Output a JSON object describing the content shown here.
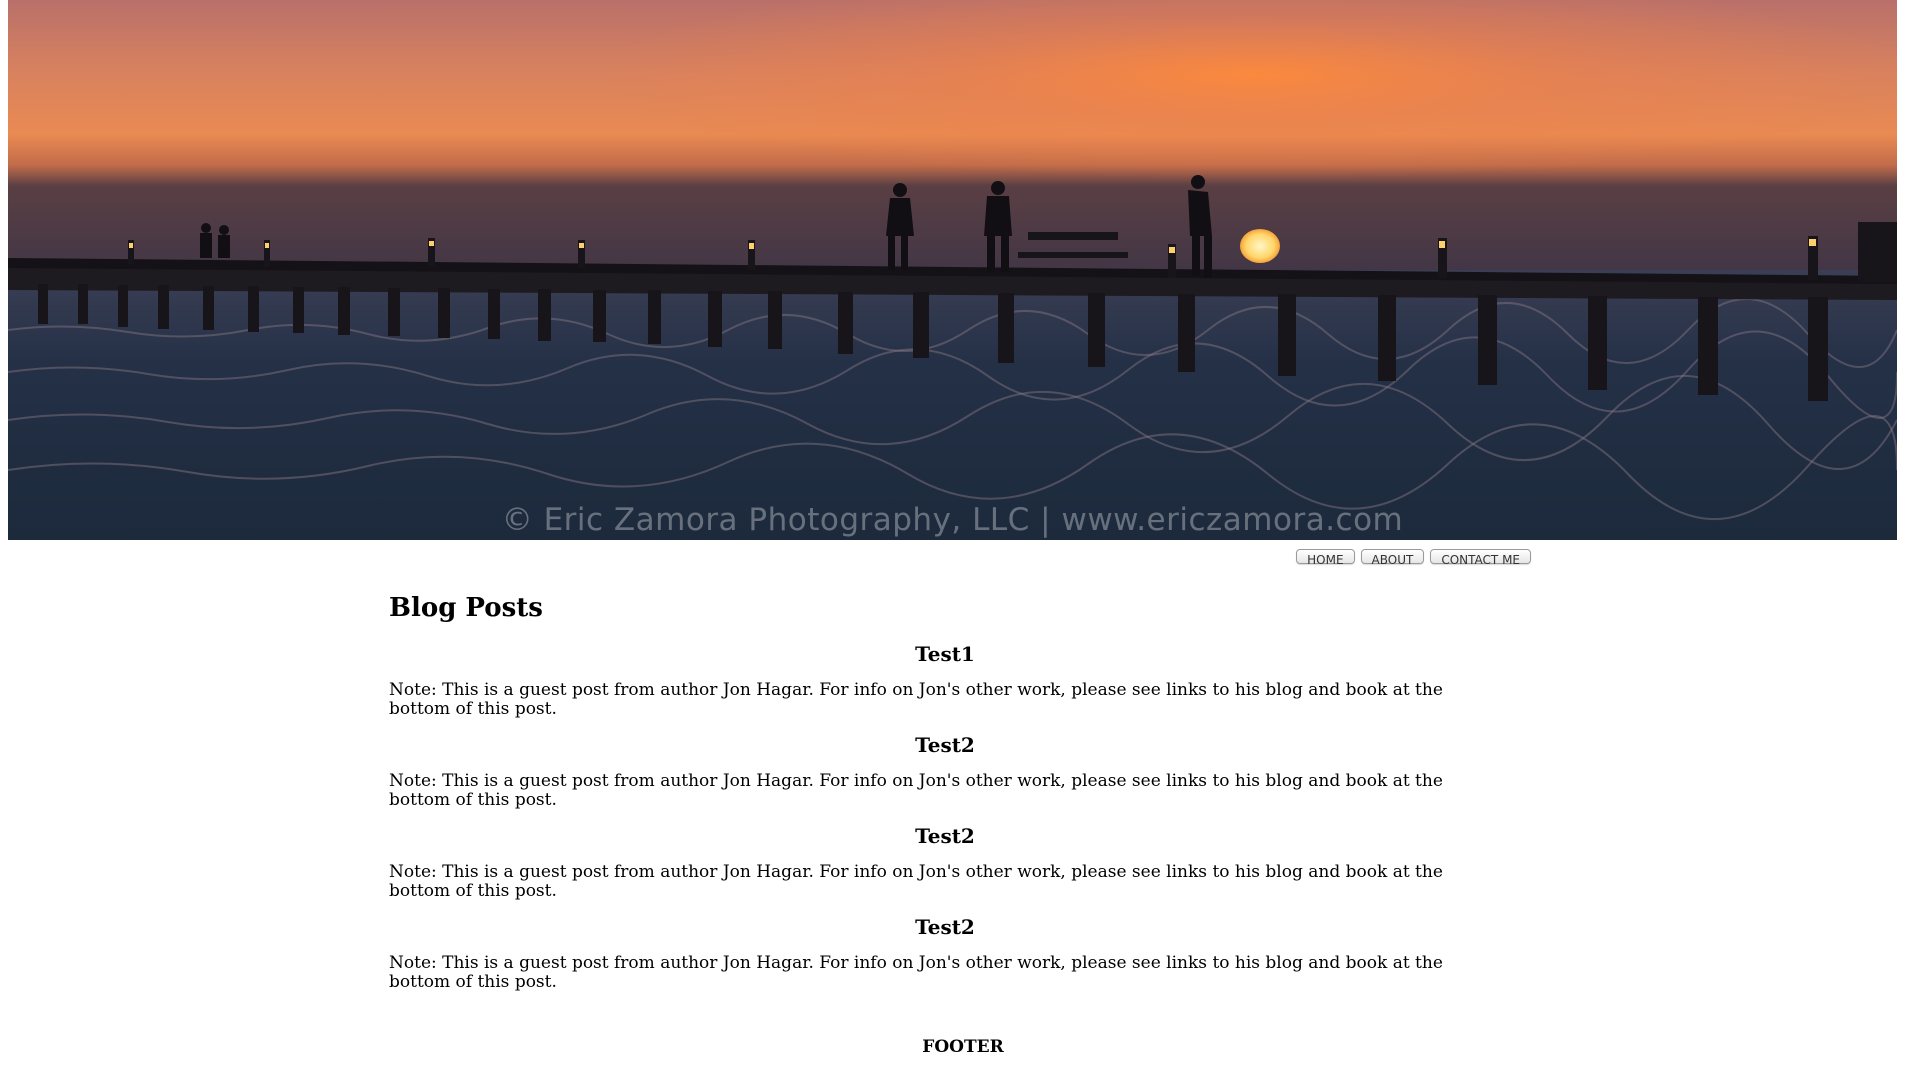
{
  "hero": {
    "copyright": "© Eric Zamora Photography, LLC | www.ericzamora.com"
  },
  "nav": {
    "items": [
      {
        "label": "HOME"
      },
      {
        "label": "ABOUT"
      },
      {
        "label": "CONTACT ME"
      }
    ]
  },
  "main": {
    "title": "Blog Posts",
    "posts": [
      {
        "title": "Test1",
        "body": "Note: This is a guest post from author Jon Hagar. For info on Jon's other work, please see links to his blog and book at the bottom of this post."
      },
      {
        "title": "Test2",
        "body": "Note: This is a guest post from author Jon Hagar. For info on Jon's other work, please see links to his blog and book at the bottom of this post."
      },
      {
        "title": "Test2",
        "body": "Note: This is a guest post from author Jon Hagar. For info on Jon's other work, please see links to his blog and book at the bottom of this post."
      },
      {
        "title": "Test2",
        "body": "Note: This is a guest post from author Jon Hagar. For info on Jon's other work, please see links to his blog and book at the bottom of this post."
      }
    ]
  },
  "footer": {
    "label": "FOOTER"
  }
}
